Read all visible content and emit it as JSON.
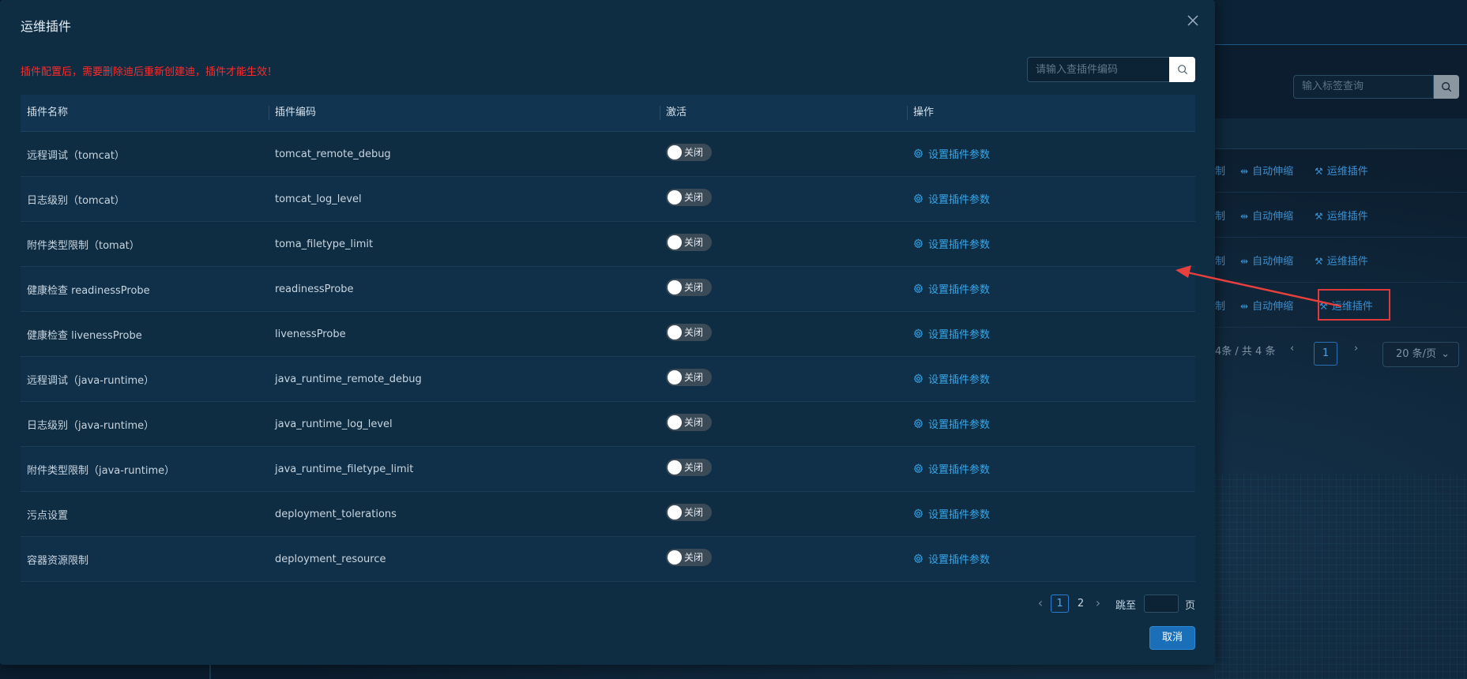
{
  "modal": {
    "title": "运维插件",
    "warning": "插件配置后，需要删除迪后重新创建迪，插件才能生效！",
    "search_placeholder": "请输入查插件编码",
    "cancel_label": "取消"
  },
  "table": {
    "headers": [
      "插件名称",
      "插件编码",
      "激活",
      "操作"
    ],
    "rows": [
      {
        "name": "远程调试（tomcat）",
        "code": "tomcat_remote_debug",
        "status": "关闭",
        "action": "设置插件参数"
      },
      {
        "name": "日志级别（tomcat）",
        "code": "tomcat_log_level",
        "status": "关闭",
        "action": "设置插件参数"
      },
      {
        "name": "附件类型限制（tomat）",
        "code": "toma_filetype_limit",
        "status": "关闭",
        "action": "设置插件参数"
      },
      {
        "name": "健康检查 readinessProbe",
        "code": "readinessProbe",
        "status": "关闭",
        "action": "设置插件参数"
      },
      {
        "name": "健康检查 livenessProbe",
        "code": "livenessProbe",
        "status": "关闭",
        "action": "设置插件参数"
      },
      {
        "name": "远程调试（java-runtime）",
        "code": "java_runtime_remote_debug",
        "status": "关闭",
        "action": "设置插件参数"
      },
      {
        "name": "日志级别（java-runtime）",
        "code": "java_runtime_log_level",
        "status": "关闭",
        "action": "设置插件参数"
      },
      {
        "name": "附件类型限制（java-runtime）",
        "code": "java_runtime_filetype_limit",
        "status": "关闭",
        "action": "设置插件参数"
      },
      {
        "name": "污点设置",
        "code": "deployment_tolerations",
        "status": "关闭",
        "action": "设置插件参数"
      },
      {
        "name": "容器资源限制",
        "code": "deployment_resource",
        "status": "关闭",
        "action": "设置插件参数"
      }
    ]
  },
  "pagination": {
    "current": "1",
    "next_page": "2",
    "jump_label": "跳至",
    "page_suffix": "页",
    "prev_icon": "‹",
    "next_icon": "›"
  },
  "background": {
    "search_placeholder": "输入标签查询",
    "row_actions": [
      "制",
      "自动伸缩",
      "运维插件"
    ],
    "pager_total": "4条 / 共 4 条",
    "pager_current": "1",
    "page_size": "20 条/页"
  },
  "colors": {
    "modal_bg": "#0e2d43",
    "warning": "#ff2a2a",
    "link": "#38a6e8",
    "highlight": "#e0393a"
  }
}
